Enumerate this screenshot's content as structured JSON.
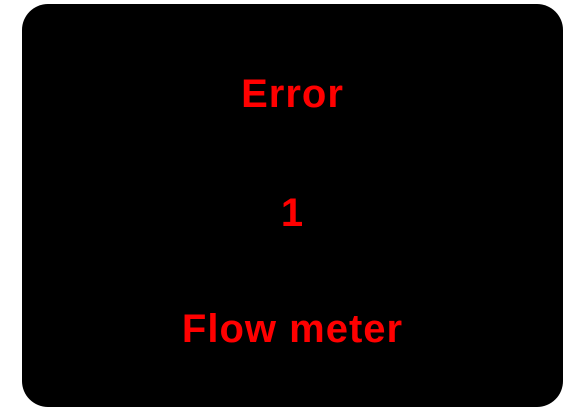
{
  "display": {
    "title": "Error",
    "code": "1",
    "description": "Flow meter"
  },
  "colors": {
    "background": "#000000",
    "text": "#ff0000"
  }
}
